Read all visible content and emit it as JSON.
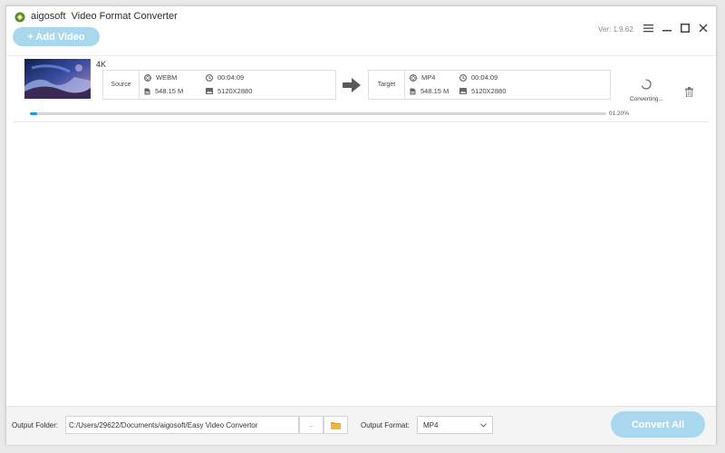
{
  "app": {
    "title": "aigosoft  Video Format Converter",
    "add_video_label": "+ Add Video",
    "version": "Ver: 1.9.62",
    "icons": {
      "menu": "menu-icon",
      "minimize": "minimize-icon",
      "maximize": "maximize-icon",
      "close": "close-icon"
    }
  },
  "task": {
    "name": "4K",
    "source": {
      "label": "Source",
      "format": "WEBM",
      "duration": "00:04:09",
      "size": "548.15 M",
      "resolution": "5120X2880"
    },
    "target": {
      "label": "Target",
      "format": "MP4",
      "duration": "00:04:09",
      "size": "548.15 M",
      "resolution": "5120X2880"
    },
    "status": "Converting...",
    "progress_text": "01.20%",
    "progress_fraction": 0.012
  },
  "footer": {
    "output_folder_label": "Output Folder:",
    "output_folder_value": "C:/Users/29622/Documents/aigosoft/Easy Video Convertor",
    "browse_label": "...",
    "output_format_label": "Output Format:",
    "output_format_value": "MP4",
    "convert_all_label": "Convert All"
  },
  "colors": {
    "accent_light": "#a9d8ee",
    "progress": "#1e9bd7",
    "folder_icon": "#e8a423"
  }
}
